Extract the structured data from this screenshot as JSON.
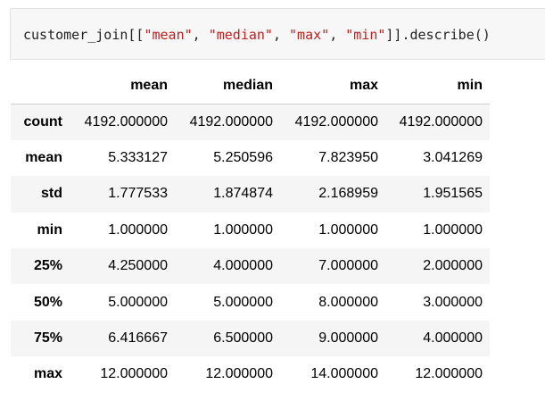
{
  "code_cell": {
    "tokens": [
      {
        "text": "customer_join[[",
        "kind": "name"
      },
      {
        "text": "\"mean\"",
        "kind": "str"
      },
      {
        "text": ", ",
        "kind": "op"
      },
      {
        "text": "\"median\"",
        "kind": "str"
      },
      {
        "text": ", ",
        "kind": "op"
      },
      {
        "text": "\"max\"",
        "kind": "str"
      },
      {
        "text": ", ",
        "kind": "op"
      },
      {
        "text": "\"min\"",
        "kind": "str"
      },
      {
        "text": "]].describe()",
        "kind": "name"
      }
    ]
  },
  "table": {
    "columns": [
      "mean",
      "median",
      "max",
      "min"
    ],
    "rows": [
      {
        "label": "count",
        "values": [
          "4192.000000",
          "4192.000000",
          "4192.000000",
          "4192.000000"
        ]
      },
      {
        "label": "mean",
        "values": [
          "5.333127",
          "5.250596",
          "7.823950",
          "3.041269"
        ]
      },
      {
        "label": "std",
        "values": [
          "1.777533",
          "1.874874",
          "2.168959",
          "1.951565"
        ]
      },
      {
        "label": "min",
        "values": [
          "1.000000",
          "1.000000",
          "1.000000",
          "1.000000"
        ]
      },
      {
        "label": "25%",
        "values": [
          "4.250000",
          "4.000000",
          "7.000000",
          "2.000000"
        ]
      },
      {
        "label": "50%",
        "values": [
          "5.000000",
          "5.000000",
          "8.000000",
          "3.000000"
        ]
      },
      {
        "label": "75%",
        "values": [
          "6.416667",
          "6.500000",
          "9.000000",
          "4.000000"
        ]
      },
      {
        "label": "max",
        "values": [
          "12.000000",
          "12.000000",
          "14.000000",
          "12.000000"
        ]
      }
    ]
  },
  "colors": {
    "string_literal": "#ba2121",
    "code_background": "#f7f7f7",
    "row_stripe": "#f5f5f5"
  }
}
